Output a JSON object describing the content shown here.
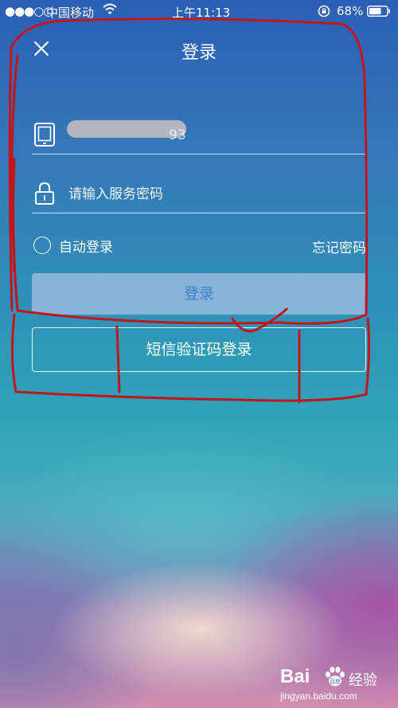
{
  "status_bar": {
    "signal": "●●●○○",
    "carrier": "中国移动",
    "time": "上午11:13",
    "battery": "68%"
  },
  "header": {
    "title": "登录",
    "close_icon": "close-icon"
  },
  "form": {
    "phone_suffix": "93",
    "password_placeholder": "请输入服务密码",
    "auto_login_label": "自动登录",
    "forgot_password_label": "忘记密码",
    "login_button_label": "登录",
    "sms_login_button_label": "短信验证码登录"
  },
  "watermark": {
    "brand_logo": "Bai",
    "brand_logo_suffix": "百度",
    "brand_name": "经验",
    "url": "jingyan.baidu.com"
  },
  "colors": {
    "annotation_ink": "#c3161c",
    "login_button_text": "#3a82c9"
  }
}
